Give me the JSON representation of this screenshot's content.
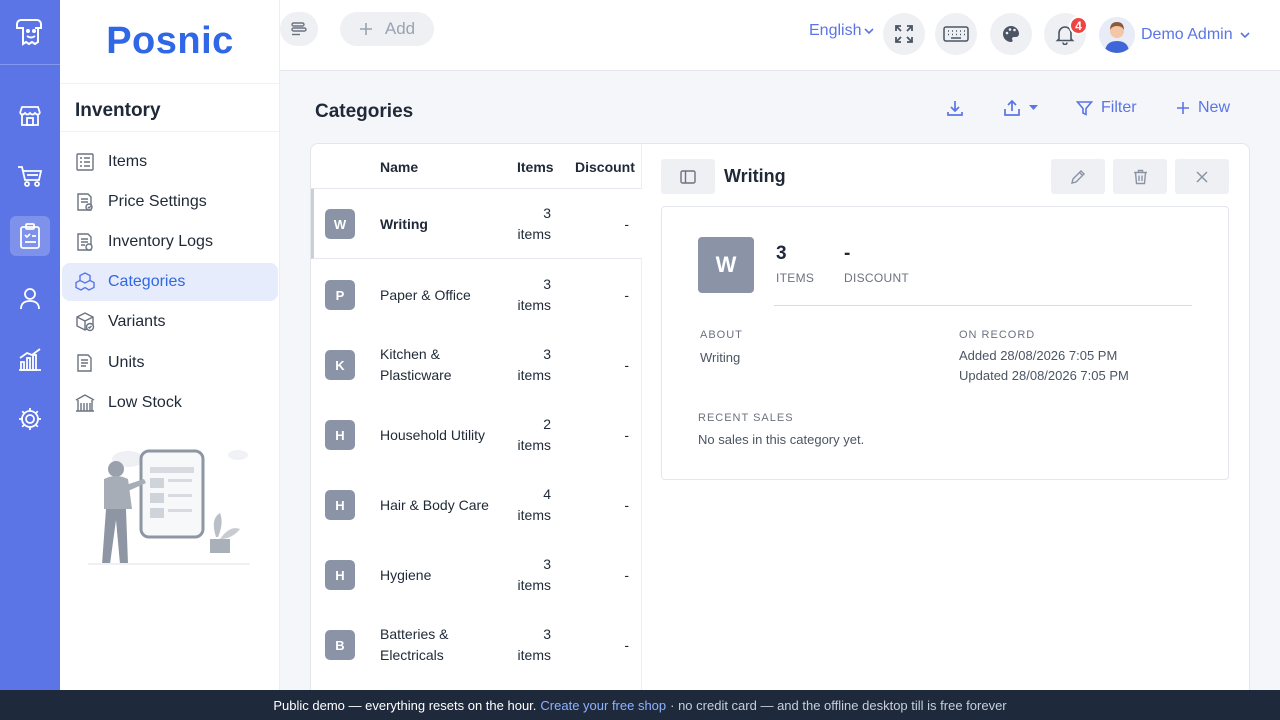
{
  "brand": {
    "name": "Posnic"
  },
  "colors": {
    "accent": "#5b74e6",
    "brand": "#2f67e6",
    "badge": "#ef4444",
    "banner_bg": "#1e293b"
  },
  "rail": {
    "logo_icon": "receipt-logo-icon",
    "items": [
      {
        "icon": "store-icon"
      },
      {
        "icon": "cart-icon"
      },
      {
        "icon": "clipboard-icon",
        "active": true
      },
      {
        "icon": "user-icon"
      },
      {
        "icon": "chart-icon"
      },
      {
        "icon": "gear-icon"
      }
    ]
  },
  "sidebar": {
    "title": "Inventory",
    "items": [
      {
        "label": "Items",
        "icon": "list-icon"
      },
      {
        "label": "Price Settings",
        "icon": "price-doc-icon"
      },
      {
        "label": "Inventory Logs",
        "icon": "log-doc-icon"
      },
      {
        "label": "Categories",
        "icon": "cubes-icon",
        "active": true
      },
      {
        "label": "Variants",
        "icon": "box-check-icon"
      },
      {
        "label": "Units",
        "icon": "unit-doc-icon"
      },
      {
        "label": "Low Stock",
        "icon": "warehouse-icon"
      }
    ]
  },
  "topbar": {
    "add_label": "Add",
    "language": "English",
    "notification_count": "4",
    "user_name": "Demo Admin"
  },
  "page": {
    "title": "Categories",
    "filter_label": "Filter",
    "new_label": "New"
  },
  "table": {
    "headers": {
      "name": "Name",
      "items": "Items",
      "discount": "Discount"
    },
    "rows": [
      {
        "letter": "W",
        "name": "Writing",
        "count": "3",
        "unit": "items",
        "discount": "-",
        "selected": true
      },
      {
        "letter": "P",
        "name": "Paper & Office",
        "count": "3",
        "unit": "items",
        "discount": "-"
      },
      {
        "letter": "K",
        "name": "Kitchen & Plasticware",
        "count": "3",
        "unit": "items",
        "discount": "-"
      },
      {
        "letter": "H",
        "name": "Household Utility",
        "count": "2",
        "unit": "items",
        "discount": "-"
      },
      {
        "letter": "H",
        "name": "Hair & Body Care",
        "count": "4",
        "unit": "items",
        "discount": "-"
      },
      {
        "letter": "H",
        "name": "Hygiene",
        "count": "3",
        "unit": "items",
        "discount": "-"
      },
      {
        "letter": "B",
        "name": "Batteries & Electricals",
        "count": "3",
        "unit": "items",
        "discount": "-"
      }
    ]
  },
  "detail": {
    "title": "Writing",
    "letter": "W",
    "items_value": "3",
    "items_label": "ITEMS",
    "discount_value": "-",
    "discount_label": "DISCOUNT",
    "about_label": "ABOUT",
    "about_text": "Writing",
    "record_label": "ON RECORD",
    "added": "Added 28/08/2026 7:05 PM",
    "updated": "Updated 28/08/2026 7:05 PM",
    "sales_label": "RECENT SALES",
    "sales_text": "No sales in this category yet."
  },
  "banner": {
    "lead": "Public demo — everything resets on the hour.",
    "link": "Create your free shop",
    "rest": "· no credit card — and the offline desktop till is free forever"
  }
}
